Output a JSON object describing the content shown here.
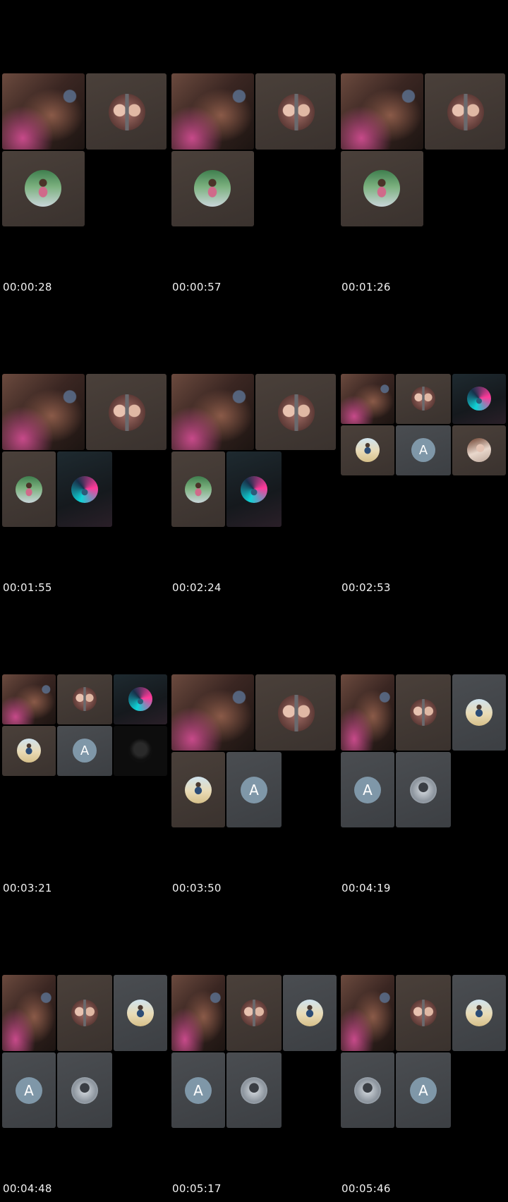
{
  "frames": [
    {
      "timestamp": "00:00:28"
    },
    {
      "timestamp": "00:00:57"
    },
    {
      "timestamp": "00:01:26"
    },
    {
      "timestamp": "00:01:55"
    },
    {
      "timestamp": "00:02:24"
    },
    {
      "timestamp": "00:02:53",
      "letter_avatar": "A"
    },
    {
      "timestamp": "00:03:21",
      "letter_avatar": "A"
    },
    {
      "timestamp": "00:03:50",
      "letter_avatar": "A"
    },
    {
      "timestamp": "00:04:19",
      "letter_avatar": "A"
    },
    {
      "timestamp": "00:04:48",
      "letter_avatar": "A"
    },
    {
      "timestamp": "00:05:17",
      "letter_avatar": "A"
    },
    {
      "timestamp": "00:05:46",
      "letter_avatar": "A"
    }
  ],
  "colors": {
    "background": "#000000",
    "tile_brown": "#3f3632",
    "tile_gray": "#43464a",
    "letter_avatar": "#7f97a8",
    "timestamp_text": "#f2f2f2"
  },
  "icons": [
    "participant-avatar",
    "participant-avatar-letter"
  ]
}
